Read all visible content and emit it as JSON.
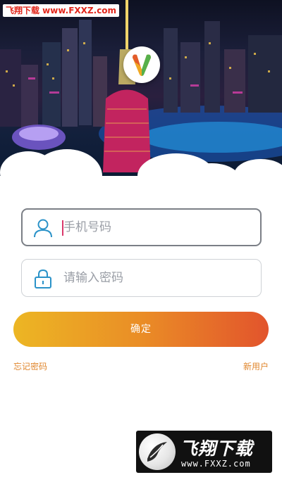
{
  "header": {
    "watermark_text": "飞翔下载 www.FXXZ.com",
    "logo_icon": "v-heart-logo-icon"
  },
  "form": {
    "phone": {
      "placeholder": "手机号码",
      "icon": "user-icon"
    },
    "password": {
      "placeholder": "请输入密码",
      "icon": "lock-icon"
    },
    "confirm_label": "确定",
    "forgot_label": "忘记密码",
    "register_label": "新用户"
  },
  "watermark_badge": {
    "title": "飞翔下载",
    "url": "www.FXXZ.com"
  },
  "colors": {
    "accent_start": "#ecb624",
    "accent_end": "#e2542c",
    "link": "#e0872e",
    "icon": "#2a92c8"
  }
}
